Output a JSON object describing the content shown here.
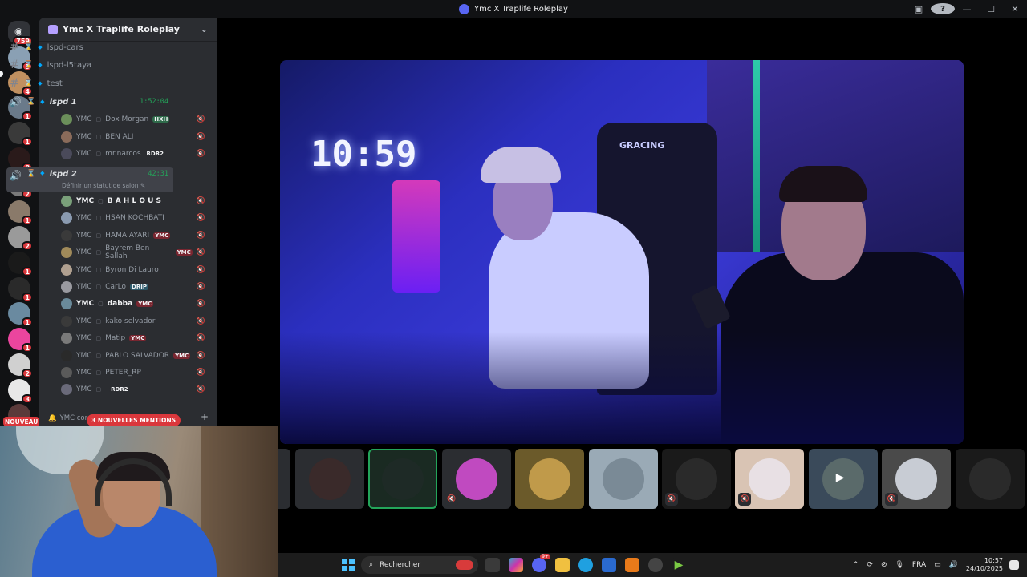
{
  "window": {
    "title": "Ymc X Traplife Roleplay",
    "controls": {
      "minimize": "—",
      "maximize": "☐",
      "close": "✕",
      "help": "?"
    }
  },
  "guilds": {
    "home_badge": "759",
    "badges": [
      "3",
      "4",
      "1",
      "1",
      "8",
      "2",
      "1",
      "2",
      "1",
      "1",
      "1",
      "1",
      "2",
      "3"
    ],
    "nouveau": "NOUVEAU"
  },
  "server": {
    "name": "Ymc X Traplife Roleplay",
    "channels": [
      {
        "name": "lspd-cars"
      },
      {
        "name": "lspd-l5taya"
      },
      {
        "name": "test"
      }
    ],
    "voice1": {
      "name": "lspd  1",
      "time": "1:52:04",
      "members": [
        {
          "prefix": "YMC",
          "name": "Dox Morgan",
          "tag": "HXH",
          "tag_color": "#2e6b4a",
          "av": "#6b8f5a"
        },
        {
          "prefix": "YMC",
          "name": "BEN ALI",
          "tag": "",
          "av": "#8a6b5a"
        },
        {
          "prefix": "YMC",
          "name": "mr.narcos",
          "tag": "RDR2",
          "tag_color": "#2b2d31",
          "av": "#4a4a5a"
        }
      ]
    },
    "voice2": {
      "name": "lspd 2",
      "time": "42:31",
      "status_hint": "Définir un statut de salon",
      "members": [
        {
          "prefix": "YMC",
          "name": "B A H L O U S",
          "tag": "",
          "av": "#7aa07a",
          "hi": true
        },
        {
          "prefix": "YMC",
          "name": "HSAN KOCHBATI",
          "tag": "",
          "av": "#8a9ab0"
        },
        {
          "prefix": "YMC",
          "name": "HAMA AYARI",
          "tag": "YMC",
          "tag_color": "#7a2630",
          "av": "#3a3a3a"
        },
        {
          "prefix": "YMC",
          "name": "Bayrem Ben Sallah",
          "tag": "YMC",
          "tag_color": "#7a2630",
          "av": "#a08a5a"
        },
        {
          "prefix": "YMC",
          "name": "Byron Di Lauro",
          "tag": "",
          "av": "#b0a090"
        },
        {
          "prefix": "YMC",
          "name": "CarLo",
          "tag": "DRIP",
          "tag_color": "#2d5a6b",
          "av": "#9a9aa0"
        },
        {
          "prefix": "YMC",
          "name": "dabba",
          "tag": "YMC",
          "tag_color": "#7a2630",
          "av": "#6a8a9a",
          "hi": true
        },
        {
          "prefix": "YMC",
          "name": "kako selvador",
          "tag": "",
          "av": "#3a3a3a"
        },
        {
          "prefix": "YMC",
          "name": "Matip",
          "tag": "YMC",
          "tag_color": "#7a2630",
          "av": "#7a7a7a"
        },
        {
          "prefix": "YMC",
          "name": "PABLO SALVADOR",
          "tag": "YMC",
          "tag_color": "#7a2630",
          "av": "#2a2a2a"
        },
        {
          "prefix": "YMC",
          "name": "PETER_RP",
          "tag": "",
          "av": "#5a5a5a"
        },
        {
          "prefix": "YMC",
          "name": "",
          "tag": "RDR2",
          "tag_color": "#2b2d31",
          "av": "#6a6a7a"
        }
      ]
    },
    "bottom_channel": "YMC cor",
    "mentions": "3 NOUVELLES MENTIONS",
    "add": "+"
  },
  "stream": {
    "clock": "10:59",
    "chair_brand": "GRACING"
  },
  "tiles": [
    {
      "bg": "#2b2d31",
      "circ": "#6a4a3a"
    },
    {
      "bg": "#2b2d31",
      "circ": "#3a2a2a"
    },
    {
      "bg": "#1a2a22",
      "circ": "#1e2a26",
      "active": true
    },
    {
      "bg": "#2b2d31",
      "circ": "#c04ac0",
      "mute": true
    },
    {
      "bg": "#6b5a2a",
      "circ": "#c09a4a"
    },
    {
      "bg": "#9aaab6",
      "circ": "#7a8a96"
    },
    {
      "bg": "#1a1a1a",
      "circ": "#2a2a2a",
      "mute": true
    },
    {
      "bg": "#d9c4b4",
      "circ": "#e8e0e4",
      "mute": true
    },
    {
      "bg": "#3a4a5a",
      "circ": "#5a6a6a",
      "cam": true
    },
    {
      "bg": "#4a4a4a",
      "circ": "#c8ccd4",
      "mute": true
    },
    {
      "bg": "#1a1a1a",
      "circ": "#2a2a2a"
    }
  ],
  "taskbar": {
    "search_placeholder": "Rechercher",
    "lang": "FRA",
    "time": "10:57",
    "date": "24/10/2025",
    "discord_badge": "9+"
  },
  "colors": {
    "accent": "#5865f2",
    "voice_green": "#23a55a",
    "mention_red": "#da373c"
  }
}
